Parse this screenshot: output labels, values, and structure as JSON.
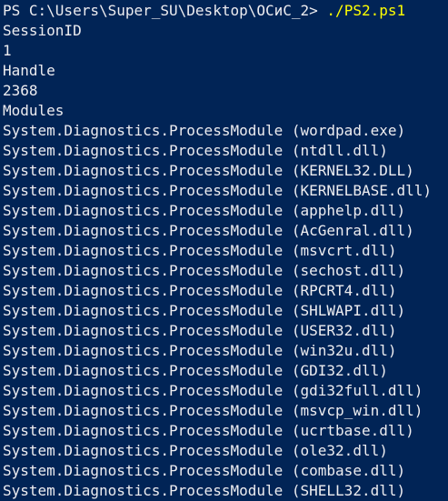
{
  "console": {
    "prompt": "PS C:\\Users\\Super_SU\\Desktop\\ОСиС_2> ",
    "command": "./PS2.ps1",
    "colors": {
      "background": "#012456",
      "text": "#eeedf0",
      "command": "#ffff00"
    },
    "output": [
      "SessionID",
      "1",
      "Handle",
      "2368",
      "Modules",
      "System.Diagnostics.ProcessModule (wordpad.exe)",
      "System.Diagnostics.ProcessModule (ntdll.dll)",
      "System.Diagnostics.ProcessModule (KERNEL32.DLL)",
      "System.Diagnostics.ProcessModule (KERNELBASE.dll)",
      "System.Diagnostics.ProcessModule (apphelp.dll)",
      "System.Diagnostics.ProcessModule (AcGenral.dll)",
      "System.Diagnostics.ProcessModule (msvcrt.dll)",
      "System.Diagnostics.ProcessModule (sechost.dll)",
      "System.Diagnostics.ProcessModule (RPCRT4.dll)",
      "System.Diagnostics.ProcessModule (SHLWAPI.dll)",
      "System.Diagnostics.ProcessModule (USER32.dll)",
      "System.Diagnostics.ProcessModule (win32u.dll)",
      "System.Diagnostics.ProcessModule (GDI32.dll)",
      "System.Diagnostics.ProcessModule (gdi32full.dll)",
      "System.Diagnostics.ProcessModule (msvcp_win.dll)",
      "System.Diagnostics.ProcessModule (ucrtbase.dll)",
      "System.Diagnostics.ProcessModule (ole32.dll)",
      "System.Diagnostics.ProcessModule (combase.dll)",
      "System.Diagnostics.ProcessModule (SHELL32.dll)"
    ]
  }
}
